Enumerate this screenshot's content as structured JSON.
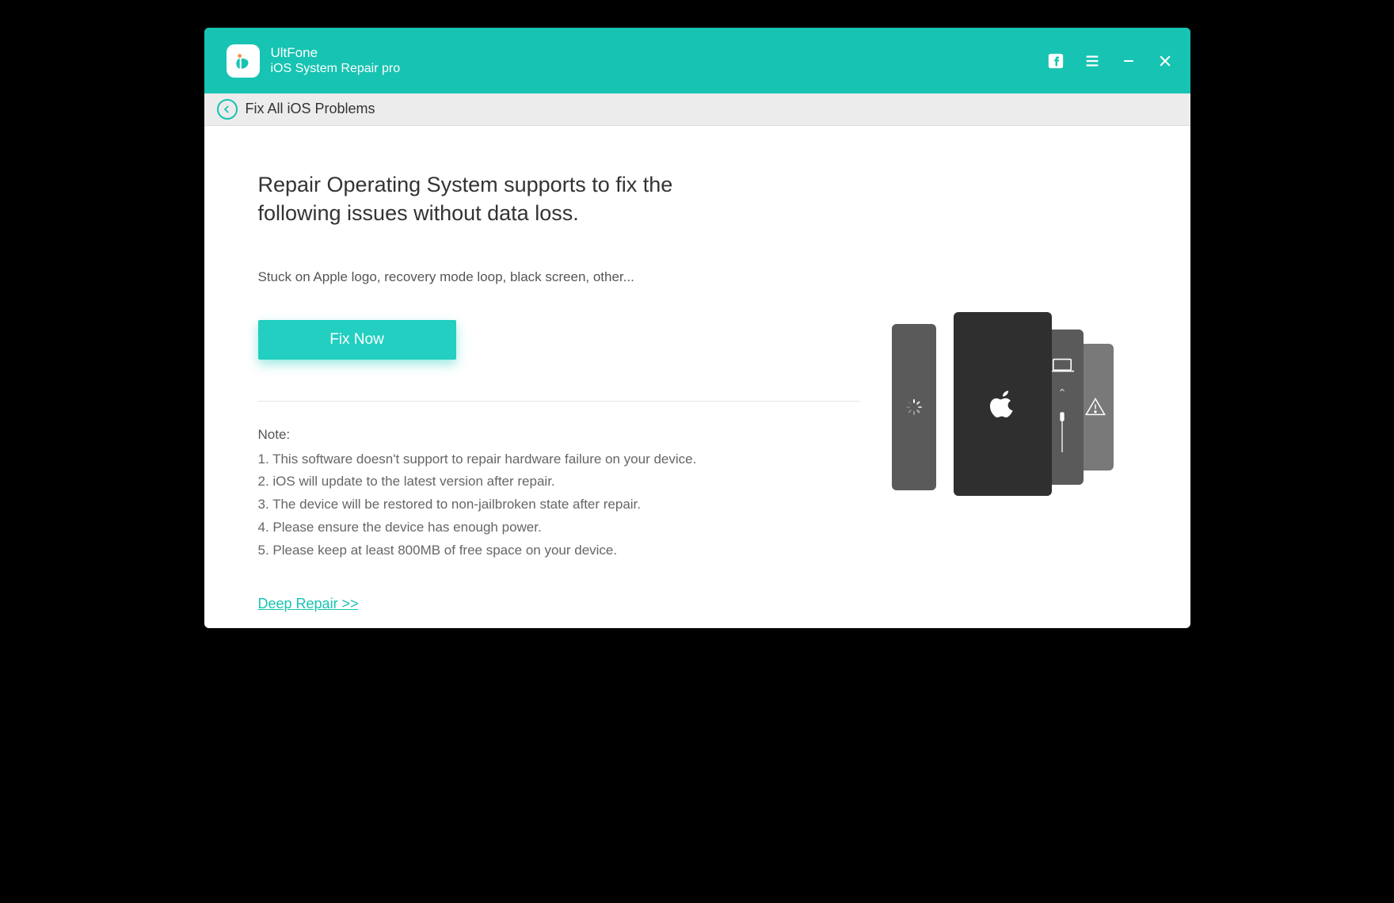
{
  "brand": {
    "name": "UltFone",
    "subtitle": "iOS System Repair pro"
  },
  "breadcrumb": {
    "label": "Fix All iOS Problems"
  },
  "main": {
    "heading": "Repair Operating System supports to fix the following issues without data loss.",
    "subtext": "Stuck on Apple logo, recovery mode loop, black screen, other...",
    "fix_button": "Fix Now",
    "note_heading": "Note:",
    "notes": [
      "1. This software doesn't support to repair hardware failure on your device.",
      "2. iOS will update to the latest version after repair.",
      "3. The device will be restored to non-jailbroken state after repair.",
      "4. Please ensure the device has enough power.",
      "5. Please keep at least 800MB of free space on your device."
    ],
    "deep_repair_link": "Deep Repair >>"
  }
}
